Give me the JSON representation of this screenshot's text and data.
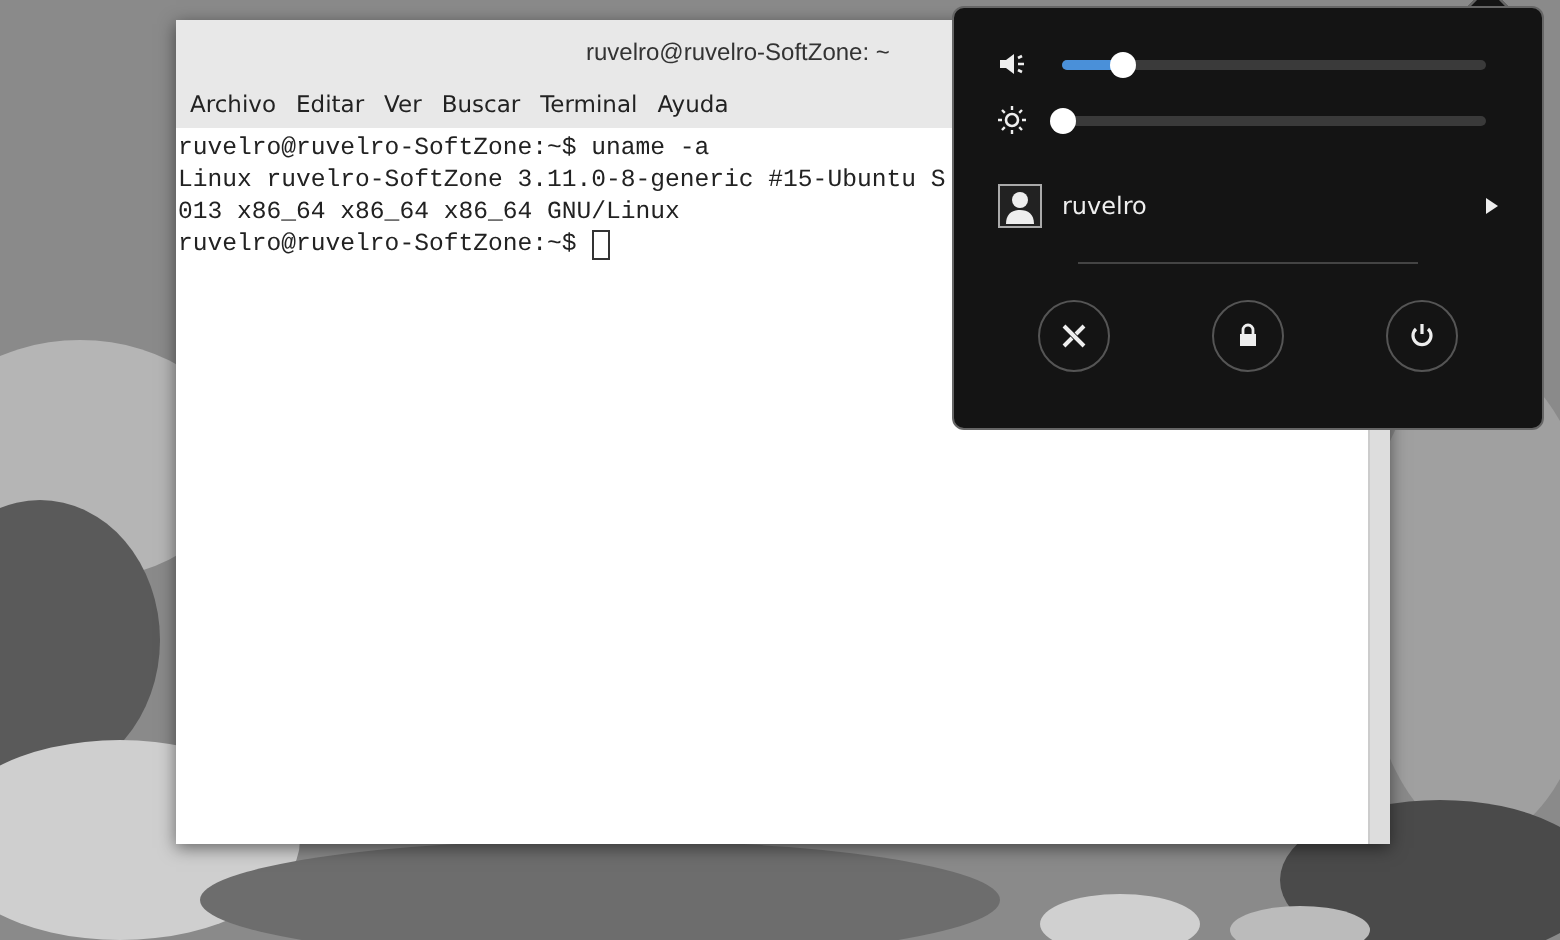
{
  "terminal": {
    "title": "ruvelro@ruvelro-SoftZone: ~",
    "menu": [
      "Archivo",
      "Editar",
      "Ver",
      "Buscar",
      "Terminal",
      "Ayuda"
    ],
    "lines": [
      "ruvelro@ruvelro-SoftZone:~$ uname -a",
      "Linux ruvelro-SoftZone 3.11.0-8-generic #15-Ubuntu S",
      "013 x86_64 x86_64 x86_64 GNU/Linux",
      "ruvelro@ruvelro-SoftZone:~$ "
    ],
    "cursor": true
  },
  "system_menu": {
    "sliders": [
      {
        "kind": "volume",
        "level": 0.14
      },
      {
        "kind": "brightness",
        "level": 0.0
      }
    ],
    "user": {
      "name": "ruvelro"
    },
    "actions": [
      {
        "kind": "settings"
      },
      {
        "kind": "lock"
      },
      {
        "kind": "power"
      }
    ]
  }
}
